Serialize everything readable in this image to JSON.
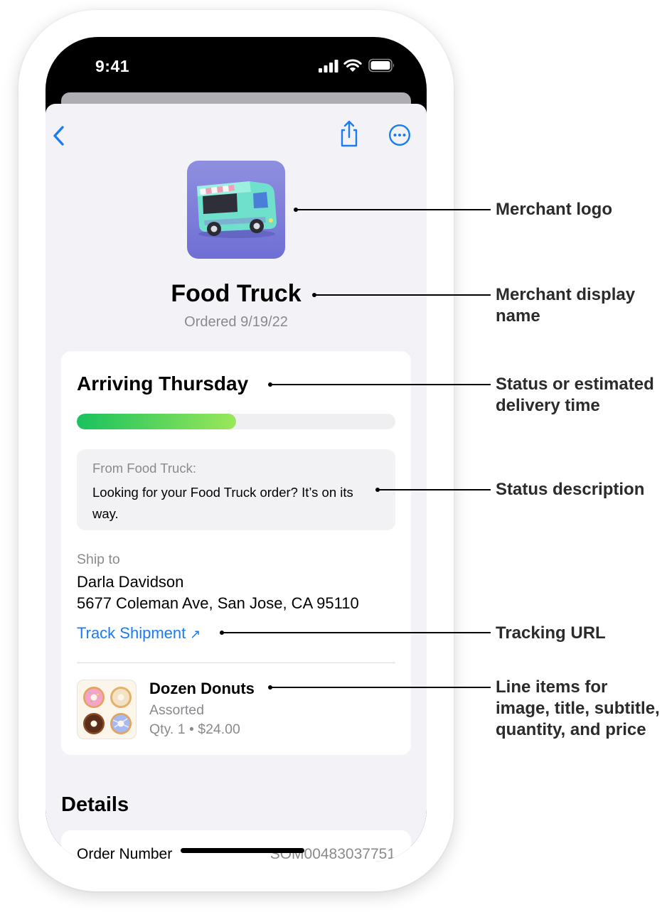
{
  "status_bar": {
    "time": "9:41"
  },
  "nav": {
    "back_icon": "chevron-left-icon",
    "share_icon": "share-icon",
    "more_icon": "ellipsis-circle-icon"
  },
  "merchant": {
    "logo": "food-truck-logo",
    "name": "Food Truck",
    "ordered": "Ordered 9/19/22"
  },
  "status": {
    "title": "Arriving Thursday",
    "progress_percent": 50,
    "progress_colors": [
      "#18c25e",
      "#9be75a"
    ],
    "message_from": "From Food Truck:",
    "message": "Looking for your Food Truck order? It’s on its way."
  },
  "shipping": {
    "label": "Ship to",
    "name": "Darla Davidson",
    "address": "5677 Coleman Ave, San Jose, CA 95110",
    "track_label": "Track Shipment",
    "track_arrow": "↗",
    "link_color": "#1a7cf0"
  },
  "line_item": {
    "image": "donuts-image",
    "title": "Dozen Donuts",
    "subtitle": "Assorted",
    "quantity_price": "Qty. 1 • $24.00"
  },
  "details": {
    "heading": "Details",
    "order_number_label": "Order Number",
    "order_number_value": "SOM00483037751"
  },
  "callouts": {
    "merchant_logo": "Merchant logo",
    "merchant_name": "Merchant display name",
    "status": "Status or estimated delivery time",
    "status_description": "Status description",
    "tracking_url": "Tracking URL",
    "line_items": "Line items for image, title, subtitle, quantity, and price"
  }
}
